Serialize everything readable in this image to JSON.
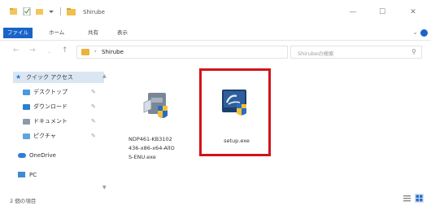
{
  "title_bar": {
    "title": "Shirube",
    "controls": {
      "minimize": "—",
      "maximize": "☐",
      "close": "✕"
    }
  },
  "ribbon": {
    "tabs": [
      "ファイル",
      "ホーム",
      "共有",
      "表示"
    ]
  },
  "address_bar": {
    "path": "Shirube",
    "separator": "›",
    "search_placeholder": "Shirubeの検索"
  },
  "nav_pane": {
    "items": [
      {
        "label": "クイック アクセス",
        "icon": "star-icon",
        "pinned": false
      },
      {
        "label": "デスクトップ",
        "icon": "folder-icon",
        "pinned": true
      },
      {
        "label": "ダウンロード",
        "icon": "folder-icon",
        "pinned": true
      },
      {
        "label": "ドキュメント",
        "icon": "folder-icon",
        "pinned": true
      },
      {
        "label": "ピクチャ",
        "icon": "folder-icon",
        "pinned": true
      },
      {
        "label": "OneDrive",
        "icon": "cloud-icon",
        "pinned": false
      },
      {
        "label": "PC",
        "icon": "pc-icon",
        "pinned": false
      }
    ]
  },
  "files": [
    {
      "name_lines": [
        "NDP461-KB3102",
        "436-x86-x64-AllO",
        "S-ENU.exe"
      ],
      "icon": "installer-icon"
    },
    {
      "name_lines": [
        "setup.exe"
      ],
      "icon": "setup-icon",
      "highlighted": true
    }
  ],
  "status_bar": {
    "text": "2 個の項目"
  },
  "colors": {
    "accent": "#1a64c8",
    "highlight": "#d3131a",
    "nav_selected": "#dbe6f3"
  }
}
